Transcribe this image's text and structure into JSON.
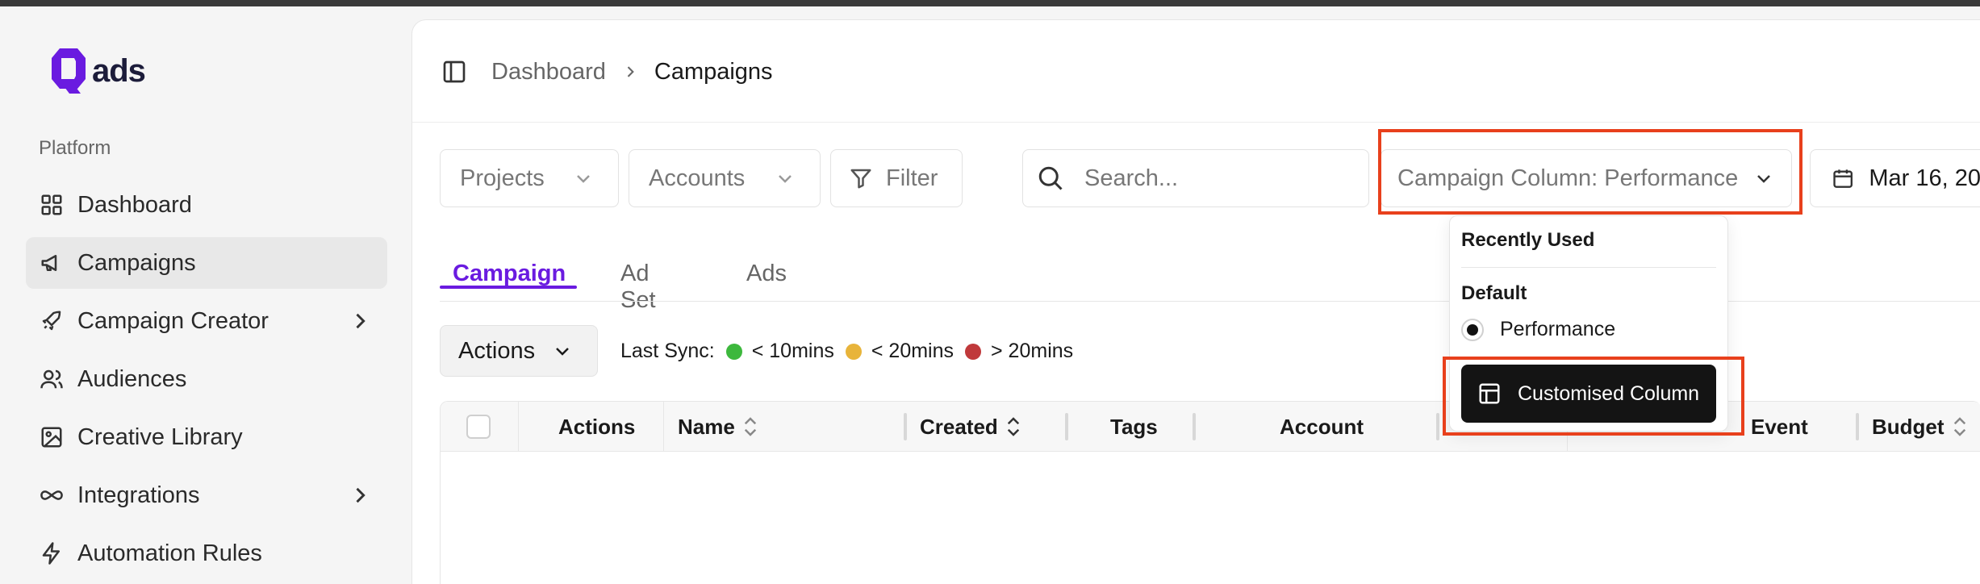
{
  "brand": {
    "logo_text": "ads",
    "accent": "#6a1be0"
  },
  "sidebar": {
    "section_label": "Platform",
    "items": [
      {
        "label": "Dashboard",
        "icon": "grid-icon",
        "active": false
      },
      {
        "label": "Campaigns",
        "icon": "megaphone-icon",
        "active": true
      },
      {
        "label": "Campaign Creator",
        "icon": "rocket-icon",
        "active": false,
        "has_submenu": true
      },
      {
        "label": "Audiences",
        "icon": "users-icon",
        "active": false
      },
      {
        "label": "Creative Library",
        "icon": "image-icon",
        "active": false
      },
      {
        "label": "Integrations",
        "icon": "infinity-icon",
        "active": false,
        "has_submenu": true
      },
      {
        "label": "Automation Rules",
        "icon": "bolt-icon",
        "active": false
      }
    ]
  },
  "breadcrumb": {
    "parent": "Dashboard",
    "current": "Campaigns"
  },
  "toolbar": {
    "projects_label": "Projects",
    "accounts_label": "Accounts",
    "filter_label": "Filter",
    "search_placeholder": "Search...",
    "column_select_label": "Campaign Column: Performance",
    "date_label": "Mar 16, 20"
  },
  "tabs": [
    {
      "label": "Campaign",
      "active": true
    },
    {
      "label": "Ad Set",
      "active": false
    },
    {
      "label": "Ads",
      "active": false
    }
  ],
  "actions_label": "Actions",
  "sync": {
    "label": "Last Sync:",
    "levels": [
      {
        "text": "< 10mins",
        "color": "#3db83d"
      },
      {
        "text": "< 20mins",
        "color": "#e8b43a"
      },
      {
        "text": "> 20mins",
        "color": "#c0393b"
      }
    ]
  },
  "table": {
    "columns": [
      "Actions",
      "Name",
      "Created",
      "Tags",
      "Account",
      "Event",
      "Budget"
    ]
  },
  "dropdown": {
    "recently_used": "Recently Used",
    "default_label": "Default",
    "option": "Performance",
    "custom_button": "Customised Column"
  }
}
